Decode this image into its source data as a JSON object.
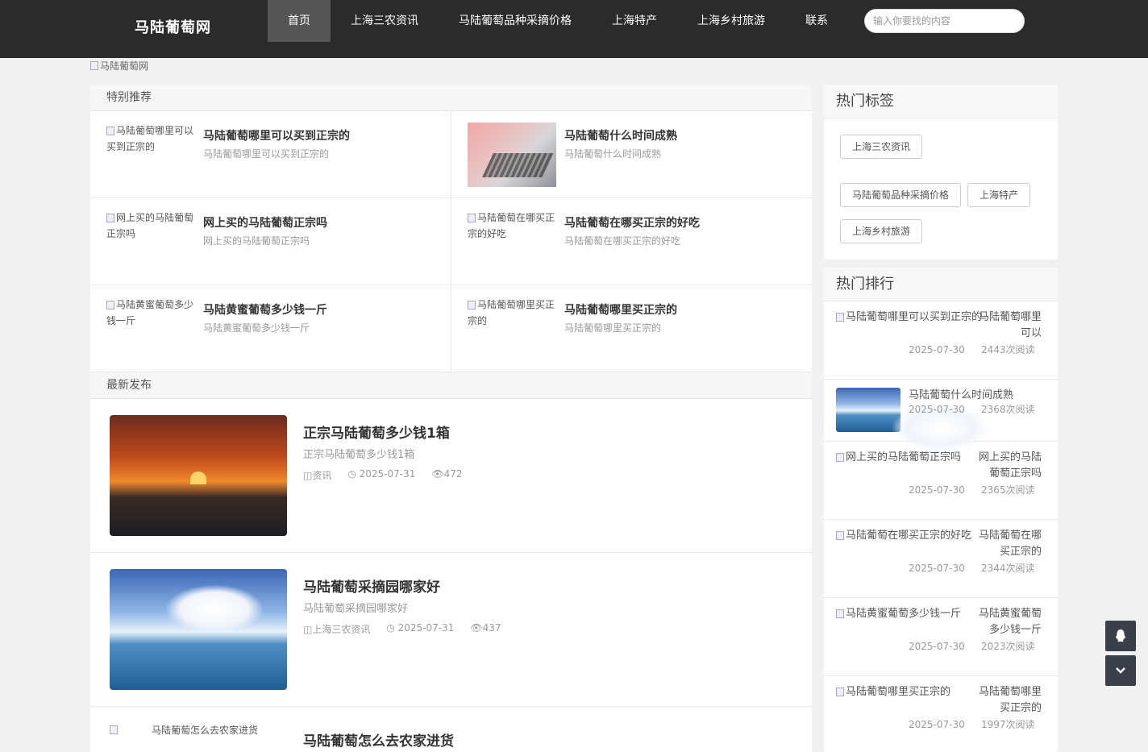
{
  "header": {
    "logo": "马陆葡萄网",
    "nav": [
      "首页",
      "上海三农资讯",
      "马陆葡萄品种采摘价格",
      "上海特产",
      "上海乡村旅游",
      "联系"
    ],
    "search_placeholder": "输入你要找的内容"
  },
  "banner_alt": "马陆葡萄网",
  "recommend": {
    "title": "特别推荐",
    "items": [
      {
        "img_alt": "马陆葡萄哪里可以买到正宗的",
        "title": "马陆葡萄哪里可以买到正宗的",
        "desc": "马陆葡萄哪里可以买到正宗的"
      },
      {
        "img_alt": "",
        "title": "马陆葡萄什么时间成熟",
        "desc": "马陆葡萄什么时间成熟"
      },
      {
        "img_alt": "网上买的马陆葡萄正宗吗",
        "title": "网上买的马陆葡萄正宗吗",
        "desc": "网上买的马陆葡萄正宗吗"
      },
      {
        "img_alt": "马陆葡萄在哪买正宗的好吃",
        "title": "马陆葡萄在哪买正宗的好吃",
        "desc": "马陆葡萄在哪买正宗的好吃"
      },
      {
        "img_alt": "马陆黄蜜葡萄多少钱一斤",
        "title": "马陆黄蜜葡萄多少钱一斤",
        "desc": "马陆黄蜜葡萄多少钱一斤"
      },
      {
        "img_alt": "马陆葡萄哪里买正宗的",
        "title": "马陆葡萄哪里买正宗的",
        "desc": "马陆葡萄哪里买正宗的"
      }
    ]
  },
  "latest": {
    "title": "最新发布",
    "items": [
      {
        "title": "正宗马陆葡萄多少钱1箱",
        "desc": "正宗马陆葡萄多少钱1箱",
        "category": "资讯",
        "date": "2025-07-31",
        "views": "472"
      },
      {
        "title": "马陆葡萄采摘园哪家好",
        "desc": "马陆葡萄采摘园哪家好",
        "category": "上海三农资讯",
        "date": "2025-07-31",
        "views": "437"
      },
      {
        "img_alt": "马陆葡萄怎么去农家进货",
        "title": "马陆葡萄怎么去农家进货"
      }
    ]
  },
  "hot_tags": {
    "title": "热门标签",
    "tags": [
      "上海三农资讯",
      "马陆葡萄品种采摘价格",
      "上海特产",
      "上海乡村旅游"
    ]
  },
  "hot_rank": {
    "title": "热门排行",
    "items": [
      {
        "img_alt": "马陆葡萄哪里可以买到正宗的",
        "title": "马陆葡萄哪里可以",
        "date": "2025-07-30",
        "views": "2443次阅读"
      },
      {
        "title": "马陆葡萄什么时间成熟",
        "date": "2025-07-30",
        "views": "2368次阅读"
      },
      {
        "img_alt": "网上买的马陆葡萄正宗吗",
        "title": "网上买的马陆葡萄正宗吗",
        "date": "2025-07-30",
        "views": "2365次阅读"
      },
      {
        "img_alt": "马陆葡萄在哪买正宗的好吃",
        "title": "马陆葡萄在哪买正宗的",
        "date": "2025-07-30",
        "views": "2344次阅读"
      },
      {
        "img_alt": "马陆黄蜜葡萄多少钱一斤",
        "title": "马陆黄蜜葡萄多少钱一斤",
        "date": "2025-07-30",
        "views": "2023次阅读"
      },
      {
        "img_alt": "马陆葡萄哪里买正宗的",
        "title": "马陆葡萄哪里买正宗的",
        "date": "2025-07-30",
        "views": "1997次阅读"
      }
    ]
  },
  "icons": {
    "qq": "qq-icon",
    "scroll_down": "chevron-down-icon"
  }
}
